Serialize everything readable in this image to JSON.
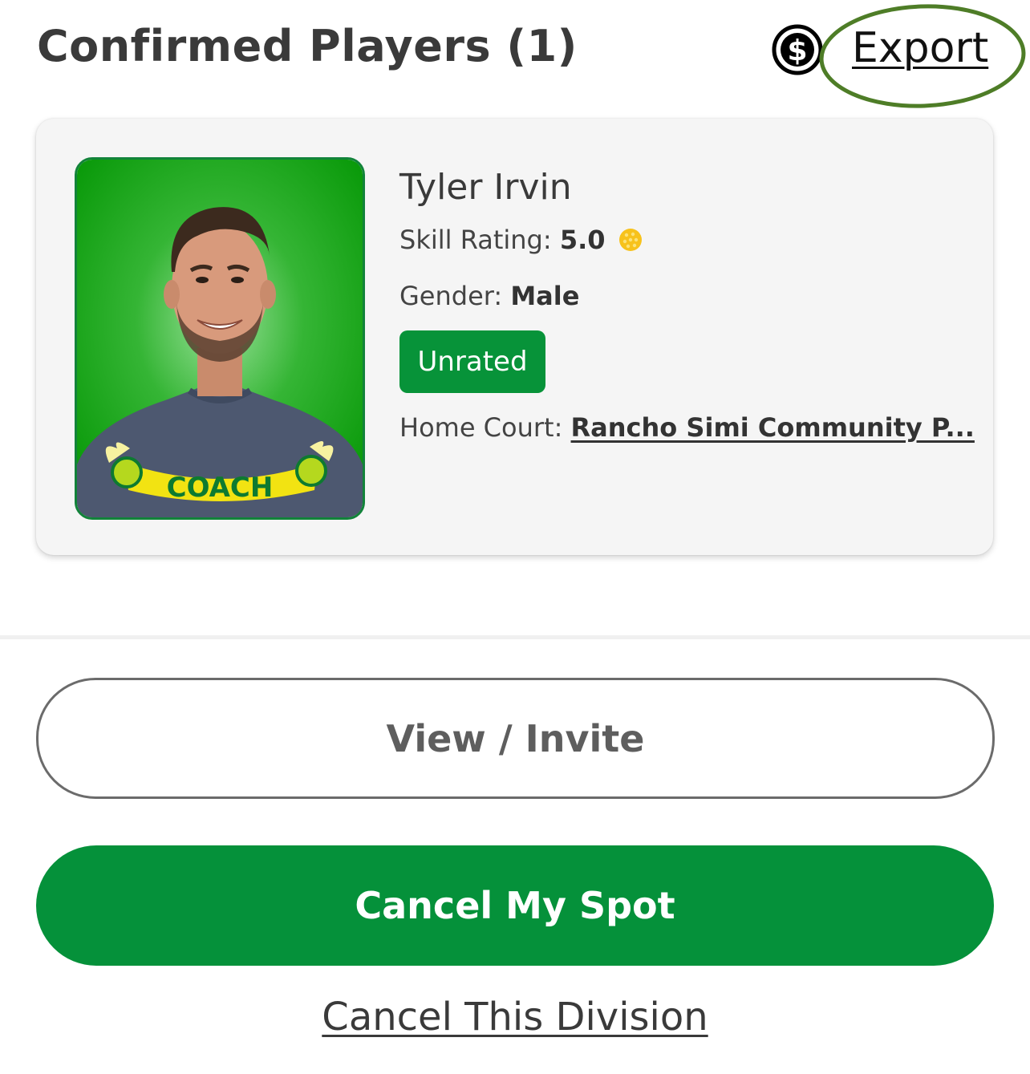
{
  "header": {
    "title": "Confirmed Players (1)",
    "export_label": "Export",
    "export_icon": "dollar-circle-icon"
  },
  "annotation": {
    "color": "#4e7d27",
    "shapes": [
      "ellipse-around-export",
      "arrow-pointing-to-export"
    ]
  },
  "player": {
    "name": "Tyler Irvin",
    "skill_label": "Skill Rating:",
    "skill_value": "5.0",
    "skill_icon": "pickleball-icon",
    "gender_label": "Gender:",
    "gender_value": "Male",
    "badge": "Unrated",
    "home_court_label": "Home Court:",
    "home_court_value": "Rancho Simi Community P...",
    "photo_shirt_text": "COACH"
  },
  "actions": {
    "view_invite": "View / Invite",
    "cancel_spot": "Cancel My Spot",
    "cancel_division": "Cancel This Division"
  },
  "colors": {
    "accent_green": "#05913a",
    "badge_green": "#079339",
    "photo_bg": "#1aa51a",
    "card_bg": "#f5f5f5"
  }
}
